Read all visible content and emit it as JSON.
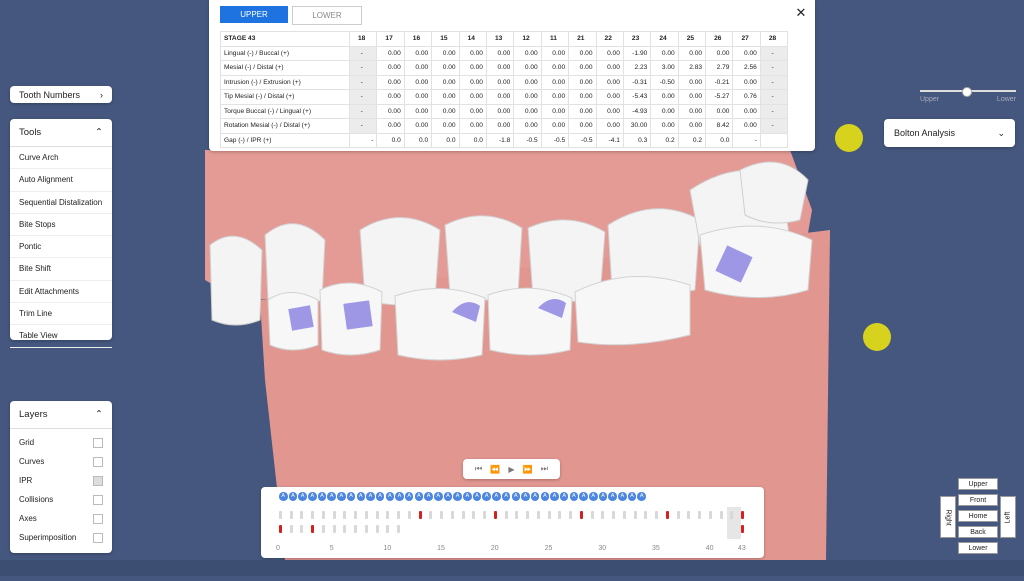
{
  "tooth_numbers": {
    "label": "Tooth Numbers"
  },
  "tools": {
    "title": "Tools",
    "items": [
      "Curve Arch",
      "Auto Alignment",
      "Sequential Distalization",
      "Bite Stops",
      "Pontic",
      "Bite Shift",
      "Edit Attachments",
      "Trim Line",
      "Table View"
    ]
  },
  "layers": {
    "title": "Layers",
    "items": [
      {
        "label": "Grid",
        "checked": false
      },
      {
        "label": "Curves",
        "checked": false
      },
      {
        "label": "IPR",
        "checked": true
      },
      {
        "label": "Collisions",
        "checked": false
      },
      {
        "label": "Axes",
        "checked": false
      },
      {
        "label": "Superimposition",
        "checked": false
      }
    ]
  },
  "table": {
    "tabs": [
      "UPPER",
      "LOWER"
    ],
    "active_tab": "UPPER",
    "stage_label": "STAGE 43",
    "columns": [
      "18",
      "17",
      "16",
      "15",
      "14",
      "13",
      "12",
      "11",
      "21",
      "22",
      "23",
      "24",
      "25",
      "26",
      "27",
      "28"
    ],
    "rows": [
      {
        "label": "Lingual (-) / Buccal (+)",
        "values": [
          "-",
          "0.00",
          "0.00",
          "0.00",
          "0.00",
          "0.00",
          "0.00",
          "0.00",
          "0.00",
          "0.00",
          "-1.90",
          "0.00",
          "0.00",
          "0.00",
          "0.00",
          "-"
        ]
      },
      {
        "label": "Mesial (-) / Distal (+)",
        "values": [
          "-",
          "0.00",
          "0.00",
          "0.00",
          "0.00",
          "0.00",
          "0.00",
          "0.00",
          "0.00",
          "0.00",
          "2.23",
          "3.00",
          "2.83",
          "2.79",
          "2.56",
          "-"
        ]
      },
      {
        "label": "Intrusion (-) / Extrusion (+)",
        "values": [
          "-",
          "0.00",
          "0.00",
          "0.00",
          "0.00",
          "0.00",
          "0.00",
          "0.00",
          "0.00",
          "0.00",
          "-0.31",
          "-0.50",
          "0.00",
          "-0.21",
          "0.00",
          "-"
        ]
      },
      {
        "label": "Tip Mesial (-) / Distal (+)",
        "values": [
          "-",
          "0.00",
          "0.00",
          "0.00",
          "0.00",
          "0.00",
          "0.00",
          "0.00",
          "0.00",
          "0.00",
          "-5.43",
          "0.00",
          "0.00",
          "-5.27",
          "0.76",
          "-"
        ]
      },
      {
        "label": "Torque Buccal (-) / Lingual (+)",
        "values": [
          "-",
          "0.00",
          "0.00",
          "0.00",
          "0.00",
          "0.00",
          "0.00",
          "0.00",
          "0.00",
          "0.00",
          "-4.93",
          "0.00",
          "0.00",
          "0.00",
          "0.00",
          "-"
        ]
      },
      {
        "label": "Rotation Mesial (-) / Distal (+)",
        "values": [
          "-",
          "0.00",
          "0.00",
          "0.00",
          "0.00",
          "0.00",
          "0.00",
          "0.00",
          "0.00",
          "0.00",
          "30.00",
          "0.00",
          "0.00",
          "8.42",
          "0.00",
          "-"
        ]
      },
      {
        "label": "Gap (-) / IPR (+)",
        "values": [
          "-",
          "0.0",
          "0.0",
          "0.0",
          "0.0",
          "-1.8",
          "-0.5",
          "-0.5",
          "-0.5",
          "-4.1",
          "0.3",
          "0.2",
          "0.2",
          "0.0",
          "-",
          ""
        ]
      }
    ]
  },
  "jaw_slider": {
    "left_label": "Upper",
    "right_label": "Lower",
    "value": 0.5
  },
  "bolton": {
    "label": "Bolton Analysis"
  },
  "timeline": {
    "badge_letter": "A",
    "badge_count": 38,
    "tick_labels": [
      "0",
      "5",
      "10",
      "15",
      "20",
      "25",
      "30",
      "35",
      "40",
      "43"
    ],
    "stage_count": 43,
    "current_stage": 43,
    "red_marks_upper": [
      13,
      20,
      28,
      36,
      43
    ],
    "red_marks_lower": [
      0,
      3,
      43
    ]
  },
  "view_cube": {
    "top": "Upper",
    "front": "Front",
    "home": "Home",
    "back": "Back",
    "bottom": "Lower",
    "right": "Right",
    "left": "Left"
  },
  "colors": {
    "background": "#45577e",
    "accent": "#1f73e0",
    "badge": "#4d86e0",
    "ipr_mark": "#d42020",
    "gum": "#e59b95",
    "tooth": "#f4f4f4",
    "attachment": "#9d97e6",
    "marker": "#d6d21e"
  }
}
